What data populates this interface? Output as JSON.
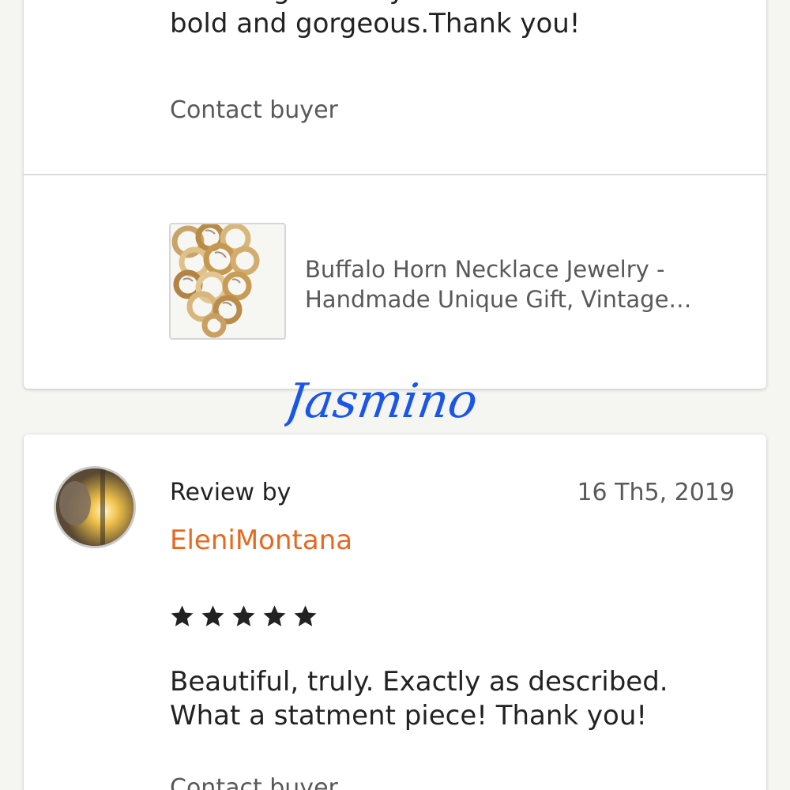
{
  "review_1": {
    "text_line1": "Stunning. Exactly as described. So",
    "text_line2": "bold and gorgeous.Thank you!",
    "contact_label": "Contact buyer"
  },
  "listing": {
    "title_line1": "Buffalo Horn Necklace Jewelry -",
    "title_line2": "Handmade Unique Gift, Vintage…",
    "thumbnail_icon": "necklace-photo"
  },
  "watermark": {
    "text": "Jasmino",
    "color": "#1a56e8"
  },
  "review_2": {
    "review_by_label": "Review by",
    "date": "16 Th5, 2019",
    "reviewer_name": "EleniMontana",
    "rating": 5,
    "rating_max": 5,
    "text_line1": "Beautiful, truly. Exactly as described.",
    "text_line2": "What a statment piece! Thank you!",
    "contact_label": "Contact buyer"
  },
  "colors": {
    "page_background": "#f5f5f1",
    "card_background": "#ffffff",
    "reviewer_name": "#e5691f",
    "muted_text": "#595959",
    "body_text": "#222222"
  }
}
